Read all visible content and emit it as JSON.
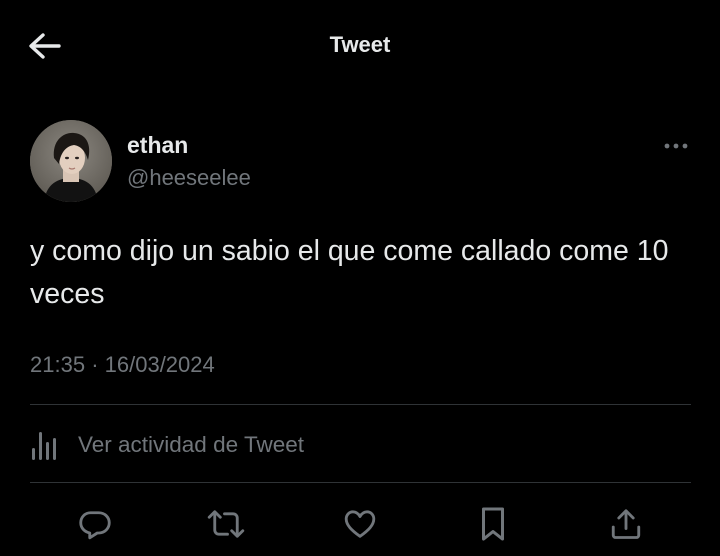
{
  "header": {
    "title": "Tweet",
    "back_icon": "arrow-left-icon"
  },
  "tweet": {
    "author": {
      "name": "ethan",
      "handle": "@heeseelee"
    },
    "text": "y como dijo un sabio el que come callado come 10 veces",
    "time": "21:35",
    "separator": "·",
    "date": "16/03/2024",
    "activity_label": "Ver actividad de Tweet"
  },
  "actions": [
    {
      "icon": "reply-icon"
    },
    {
      "icon": "retweet-icon"
    },
    {
      "icon": "like-icon"
    },
    {
      "icon": "bookmark-icon"
    },
    {
      "icon": "share-icon"
    }
  ],
  "colors": {
    "background": "#000000",
    "text_primary": "#e7e9ea",
    "text_secondary": "#71767b",
    "divider": "#2f3336"
  }
}
